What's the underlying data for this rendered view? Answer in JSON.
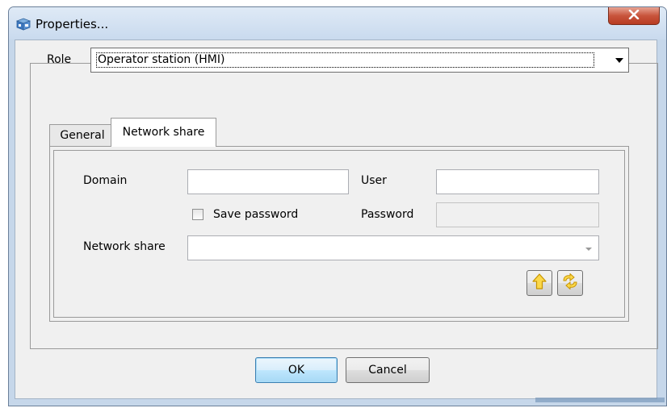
{
  "window": {
    "title": "Properties...",
    "close_label": "X"
  },
  "role": {
    "label": "Role",
    "value": "Operator station (HMI)"
  },
  "tabs": [
    {
      "label": "General",
      "active": false
    },
    {
      "label": "Network share",
      "active": true
    }
  ],
  "network_share": {
    "domain_label": "Domain",
    "domain_value": "",
    "user_label": "User",
    "user_value": "",
    "save_password_label": "Save password",
    "save_password_checked": false,
    "password_label": "Password",
    "password_value": "",
    "share_label": "Network share",
    "share_value": "",
    "upload_icon": "arrow-up-icon",
    "refresh_icon": "refresh-arrows-icon"
  },
  "buttons": {
    "ok": "OK",
    "cancel": "Cancel"
  },
  "colors": {
    "accent": "#3c7fb1",
    "arrow_yellow": "#f2c21b",
    "close_red": "#c8543c"
  }
}
